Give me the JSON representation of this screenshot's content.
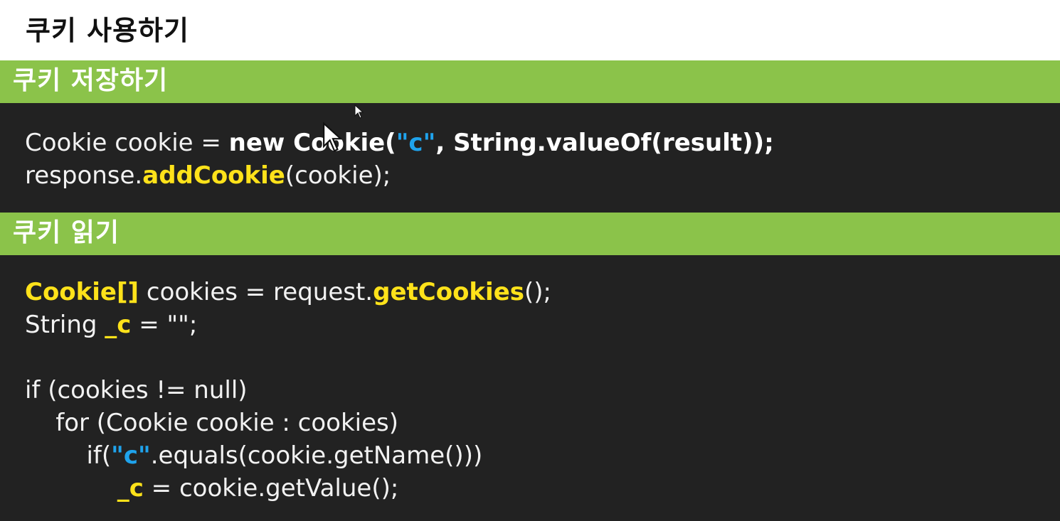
{
  "page": {
    "title": "쿠키 사용하기"
  },
  "sections": [
    {
      "header": "쿠키 저장하기",
      "lines": [
        [
          {
            "t": "Cookie cookie = ",
            "s": "plain"
          },
          {
            "t": "new Cookie(",
            "s": "bold"
          },
          {
            "t": "\"c\"",
            "s": "string"
          },
          {
            "t": ", String.valueOf(result));",
            "s": "bold"
          }
        ],
        [
          {
            "t": "response.",
            "s": "plain"
          },
          {
            "t": "addCookie",
            "s": "highlight"
          },
          {
            "t": "(cookie);",
            "s": "plain"
          }
        ]
      ]
    },
    {
      "header": "쿠키 읽기",
      "lines": [
        [
          {
            "t": "Cookie[]",
            "s": "highlight"
          },
          {
            "t": " cookies = request.",
            "s": "plain"
          },
          {
            "t": "getCookies",
            "s": "highlight"
          },
          {
            "t": "();",
            "s": "plain"
          }
        ],
        [
          {
            "t": "String ",
            "s": "plain"
          },
          {
            "t": "_c",
            "s": "highlight"
          },
          {
            "t": " = \"\";",
            "s": "plain"
          }
        ],
        [],
        [
          {
            "t": "if (cookies != null)",
            "s": "plain"
          }
        ],
        [
          {
            "t": "    for (Cookie cookie : cookies)",
            "s": "plain"
          }
        ],
        [
          {
            "t": "        if(",
            "s": "plain"
          },
          {
            "t": "\"c\"",
            "s": "string"
          },
          {
            "t": ".equals(cookie.getName()))",
            "s": "plain"
          }
        ],
        [
          {
            "t": "            ",
            "s": "plain"
          },
          {
            "t": "_c",
            "s": "highlight"
          },
          {
            "t": " = cookie.getValue();",
            "s": "plain"
          }
        ]
      ]
    }
  ],
  "colors": {
    "header_bg": "#8bc34a",
    "code_bg": "#222222",
    "highlight": "#ffe21a",
    "string": "#1fa3ec"
  },
  "icons": {
    "cursor": "mouse-pointer-icon"
  }
}
